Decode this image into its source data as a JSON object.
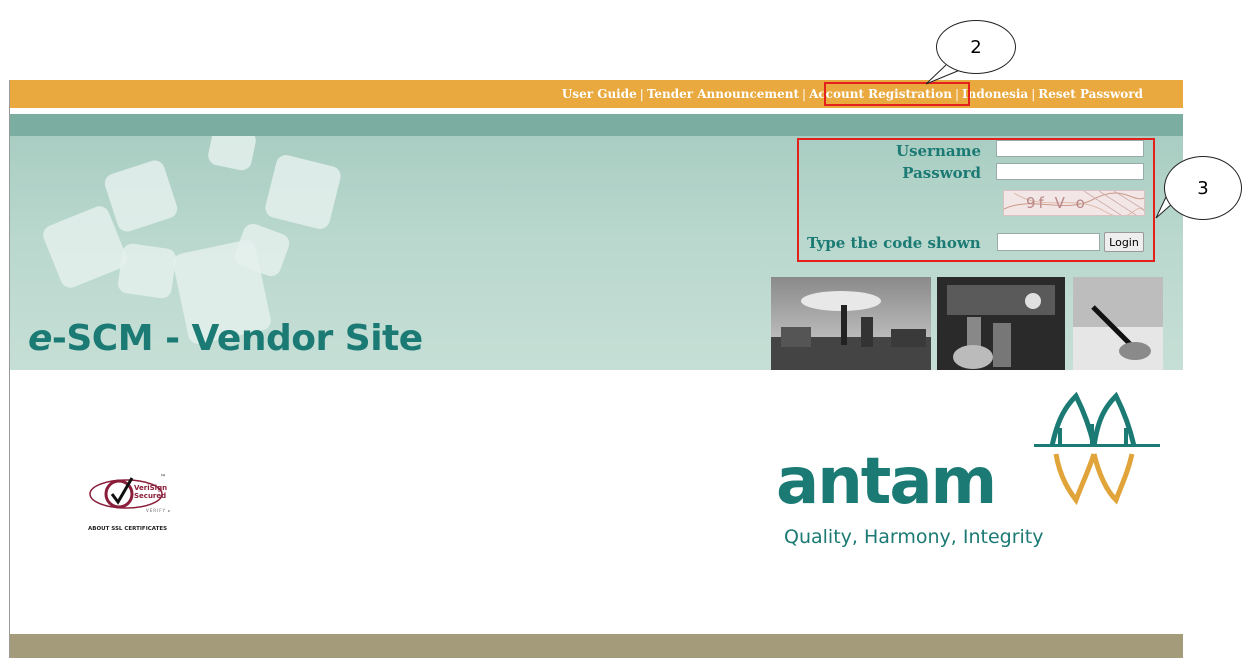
{
  "nav": {
    "user_guide": "User Guide",
    "tender_announcement": "Tender Announcement",
    "account_registration": "Account Registration",
    "language": "Indonesia",
    "reset_password": "Reset Password",
    "separator": "|"
  },
  "site": {
    "title_prefix": "e",
    "title_rest": "-SCM - Vendor Site"
  },
  "login": {
    "username_label": "Username",
    "password_label": "Password",
    "captcha_text": "9f V o",
    "code_label": "Type the code shown",
    "login_button": "Login",
    "username_value": "",
    "password_value": "",
    "code_value": ""
  },
  "callouts": {
    "two": "2",
    "three": "3"
  },
  "verisign": {
    "line1": "VeriSign",
    "line2": "Secured",
    "verify": "VERIFY ▸",
    "about": "ABOUT SSL CERTIFICATES",
    "tm": "™"
  },
  "brand": {
    "name": "antam",
    "tagline": "Quality, Harmony, Integrity"
  },
  "colors": {
    "nav": "#e9a93f",
    "teal": "#1b7a74",
    "banner": "#a9cdc2",
    "highlight": "#e3201b",
    "footer": "#a39b7a",
    "logo_gold": "#e0a43a"
  }
}
